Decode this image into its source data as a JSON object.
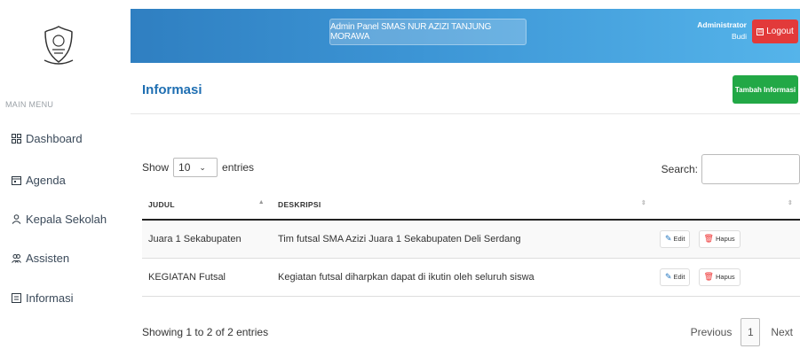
{
  "sidebar": {
    "menu_title": "MAIN MENU",
    "items": [
      {
        "label": "Dashboard",
        "icon": "grid-icon"
      },
      {
        "label": "Agenda",
        "icon": "calendar-icon"
      },
      {
        "label": "Kepala Sekolah",
        "icon": "person-icon"
      },
      {
        "label": "Assisten",
        "icon": "people-icon"
      },
      {
        "label": "Informasi",
        "icon": "info-box-icon"
      }
    ]
  },
  "header": {
    "title": "Admin Panel SMAS NUR AZIZI TANJUNG MORAWA",
    "user_role": "Administrator",
    "user_name": "Budi",
    "logout_label": "Logout"
  },
  "page": {
    "title": "Informasi",
    "add_label": "Tambah Informasi"
  },
  "table_controls": {
    "show_label": "Show",
    "show_value": "10",
    "entries_label": "entries",
    "search_label": "Search:"
  },
  "table": {
    "columns": [
      "JUDUL",
      "DESKRIPSI",
      ""
    ],
    "rows": [
      {
        "judul": "Juara 1 Sekabupaten",
        "deskripsi": "Tim futsal SMA Azizi Juara 1 Sekabupaten Deli Serdang"
      },
      {
        "judul": "KEGIATAN Futsal",
        "deskripsi": "Kegiatan futsal diharpkan dapat di ikutin oleh seluruh siswa"
      }
    ],
    "edit_label": "Edit",
    "delete_label": "Hapus"
  },
  "footer": {
    "info": "Showing 1 to 2 of 2 entries",
    "previous": "Previous",
    "page": "1",
    "next": "Next"
  },
  "colors": {
    "header_gradient_start": "#2f7fc1",
    "header_gradient_end": "#55b4ea",
    "logout": "#e23a3a",
    "add_button": "#22a846",
    "page_title": "#1f6fb2"
  }
}
